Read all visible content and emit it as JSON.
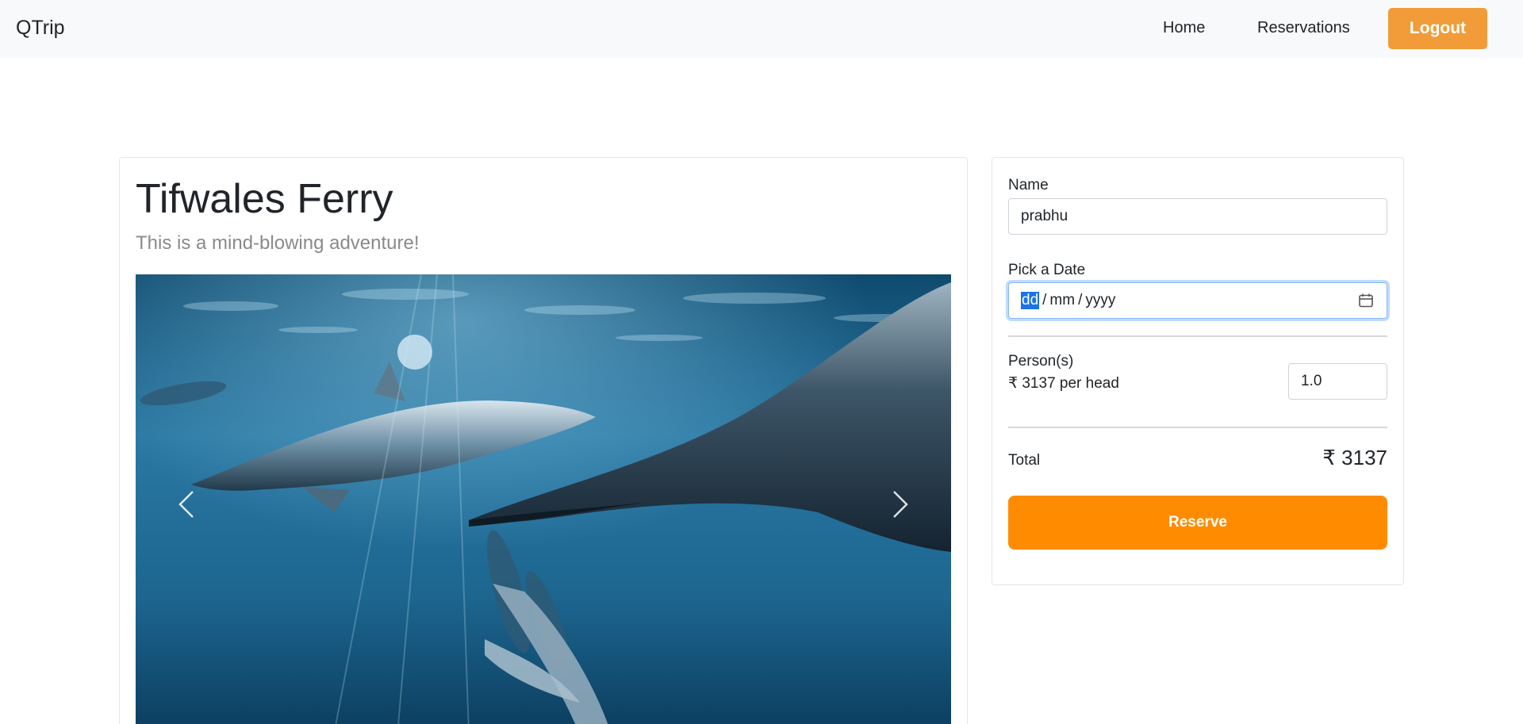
{
  "navbar": {
    "brand": "QTrip",
    "links": {
      "home": "Home",
      "reservations": "Reservations"
    },
    "logout_label": "Logout",
    "logout_color": "#f19c38"
  },
  "adventure": {
    "title": "Tifwales Ferry",
    "subtitle": "This is a mind-blowing adventure!",
    "carousel": {
      "prev_icon": "chevron-left-icon",
      "next_icon": "chevron-right-icon"
    }
  },
  "booking": {
    "name_label": "Name",
    "name_value": "prabhu",
    "date_label": "Pick a Date",
    "date_placeholder": {
      "day": "dd",
      "month": "mm",
      "year": "yyyy",
      "separator": "/"
    },
    "calendar_icon": "calendar-icon",
    "persons_label": "Person(s)",
    "price_per_head": "₹ 3137 per head",
    "persons_value": "1.0",
    "total_label": "Total",
    "total_value": "₹ 3137",
    "reserve_label": "Reserve",
    "reserve_color": "#ff8c00"
  }
}
